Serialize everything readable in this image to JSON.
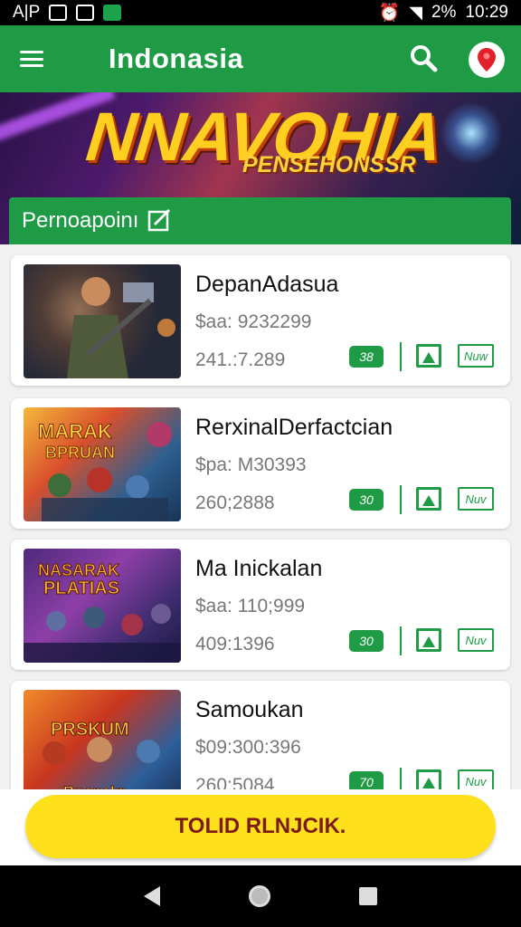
{
  "status_bar": {
    "left_text": "A|P",
    "battery": "2%",
    "time": "10:29"
  },
  "app_bar": {
    "title": "Indonasia",
    "menu_icon": "hamburger-icon",
    "search_icon": "search-icon",
    "location_icon": "location-pin-icon"
  },
  "banner": {
    "title": "NNAVOHIA",
    "subtitle": "PENSEHONSSR"
  },
  "section": {
    "title": "Pernoapoinı",
    "icon": "edit-icon"
  },
  "cards": [
    {
      "title": "DepanAdasua",
      "price": "$aa: 9232299",
      "count": "241.:7.289",
      "badge": "38",
      "action": "Nuw"
    },
    {
      "title": "RerxinalDerfactcian",
      "price": "$pa: M30393",
      "count": "260;2888",
      "badge": "30",
      "action": "Nuv"
    },
    {
      "title": "Ma Inickalan",
      "price": "$aa: 110;999",
      "count": "409:1396",
      "badge": "30",
      "action": "Nuv"
    },
    {
      "title": "Samoukan",
      "price": "$09:300:396",
      "count": "260:5084",
      "badge": "70",
      "action": "Nuv"
    }
  ],
  "cta": {
    "label": "TOLID RLNJCIK."
  },
  "colors": {
    "primary": "#1f9a45",
    "cta": "#ffe11b",
    "cta_text": "#7a1a1a"
  }
}
